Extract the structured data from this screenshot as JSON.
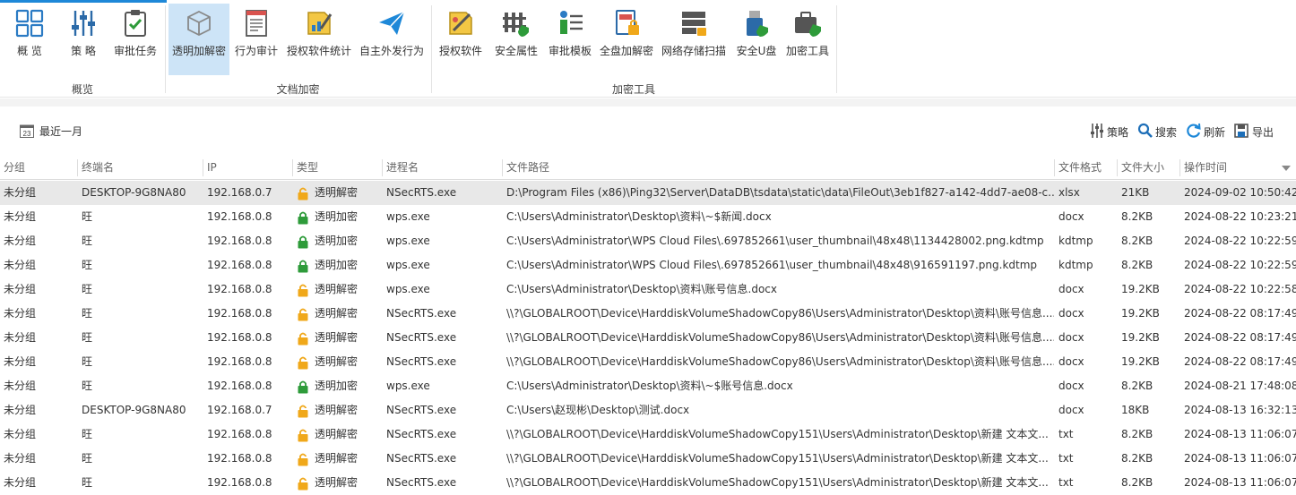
{
  "ribbon": {
    "groups": [
      {
        "label": "概览"
      },
      {
        "label": "文档加密"
      },
      {
        "label": "加密工具"
      }
    ],
    "buttons": [
      {
        "label": "概 览",
        "icon": "overview-grid-icon"
      },
      {
        "label": "策 略",
        "icon": "policy-sliders-icon"
      },
      {
        "label": "审批任务",
        "icon": "approval-clipboard-icon"
      },
      {
        "label": "透明加解密",
        "icon": "transparent-cube-icon"
      },
      {
        "label": "行为审计",
        "icon": "audit-doc-icon"
      },
      {
        "label": "授权软件统计",
        "icon": "license-stats-icon"
      },
      {
        "label": "自主外发行为",
        "icon": "send-plane-icon"
      },
      {
        "label": "授权软件",
        "icon": "license-software-icon"
      },
      {
        "label": "安全属性",
        "icon": "security-attr-icon"
      },
      {
        "label": "审批模板",
        "icon": "approval-template-icon"
      },
      {
        "label": "全盘加解密",
        "icon": "disk-encrypt-icon"
      },
      {
        "label": "网络存储扫描",
        "icon": "network-storage-icon"
      },
      {
        "label": "安全U盘",
        "icon": "secure-usb-icon"
      },
      {
        "label": "加密工具",
        "icon": "encrypt-toolbox-icon"
      }
    ]
  },
  "toolbar": {
    "date_filter": "最近一月",
    "calendar_day": "23",
    "policy": "策略",
    "search": "搜索",
    "refresh": "刷新",
    "export": "导出"
  },
  "table": {
    "columns": [
      "分组",
      "终端名",
      "IP",
      "类型",
      "进程名",
      "文件路径",
      "文件格式",
      "文件大小",
      "操作时间"
    ],
    "rows": [
      {
        "group": "未分组",
        "terminal": "DESKTOP-9G8NA80",
        "ip": "192.168.0.7",
        "type": "透明解密",
        "lock": "unlocked",
        "process": "NSecRTS.exe",
        "path": "D:\\Program Files (x86)\\Ping32\\Server\\DataDB\\tsdata\\static\\data\\FileOut\\3eb1f827-a142-4dd7-ae08-c...",
        "format": "xlsx",
        "size": "21KB",
        "time": "2024-09-02 10:50:42"
      },
      {
        "group": "未分组",
        "terminal": "旺",
        "ip": "192.168.0.8",
        "type": "透明加密",
        "lock": "locked",
        "process": "wps.exe",
        "path": "C:\\Users\\Administrator\\Desktop\\资料\\~$新闻.docx",
        "format": "docx",
        "size": "8.2KB",
        "time": "2024-08-22 10:23:21"
      },
      {
        "group": "未分组",
        "terminal": "旺",
        "ip": "192.168.0.8",
        "type": "透明加密",
        "lock": "locked",
        "process": "wps.exe",
        "path": "C:\\Users\\Administrator\\WPS Cloud Files\\.697852661\\user_thumbnail\\48x48\\1134428002.png.kdtmp",
        "format": "kdtmp",
        "size": "8.2KB",
        "time": "2024-08-22 10:22:59"
      },
      {
        "group": "未分组",
        "terminal": "旺",
        "ip": "192.168.0.8",
        "type": "透明加密",
        "lock": "locked",
        "process": "wps.exe",
        "path": "C:\\Users\\Administrator\\WPS Cloud Files\\.697852661\\user_thumbnail\\48x48\\916591197.png.kdtmp",
        "format": "kdtmp",
        "size": "8.2KB",
        "time": "2024-08-22 10:22:59"
      },
      {
        "group": "未分组",
        "terminal": "旺",
        "ip": "192.168.0.8",
        "type": "透明解密",
        "lock": "unlocked",
        "process": "wps.exe",
        "path": "C:\\Users\\Administrator\\Desktop\\资料\\账号信息.docx",
        "format": "docx",
        "size": "19.2KB",
        "time": "2024-08-22 10:22:58"
      },
      {
        "group": "未分组",
        "terminal": "旺",
        "ip": "192.168.0.8",
        "type": "透明解密",
        "lock": "unlocked",
        "process": "NSecRTS.exe",
        "path": "\\\\?\\GLOBALROOT\\Device\\HarddiskVolumeShadowCopy86\\Users\\Administrator\\Desktop\\资料\\账号信息....",
        "format": "docx",
        "size": "19.2KB",
        "time": "2024-08-22 08:17:49"
      },
      {
        "group": "未分组",
        "terminal": "旺",
        "ip": "192.168.0.8",
        "type": "透明解密",
        "lock": "unlocked",
        "process": "NSecRTS.exe",
        "path": "\\\\?\\GLOBALROOT\\Device\\HarddiskVolumeShadowCopy86\\Users\\Administrator\\Desktop\\资料\\账号信息....",
        "format": "docx",
        "size": "19.2KB",
        "time": "2024-08-22 08:17:49"
      },
      {
        "group": "未分组",
        "terminal": "旺",
        "ip": "192.168.0.8",
        "type": "透明解密",
        "lock": "unlocked",
        "process": "NSecRTS.exe",
        "path": "\\\\?\\GLOBALROOT\\Device\\HarddiskVolumeShadowCopy86\\Users\\Administrator\\Desktop\\资料\\账号信息....",
        "format": "docx",
        "size": "19.2KB",
        "time": "2024-08-22 08:17:49"
      },
      {
        "group": "未分组",
        "terminal": "旺",
        "ip": "192.168.0.8",
        "type": "透明加密",
        "lock": "locked",
        "process": "wps.exe",
        "path": "C:\\Users\\Administrator\\Desktop\\资料\\~$账号信息.docx",
        "format": "docx",
        "size": "8.2KB",
        "time": "2024-08-21 17:48:08"
      },
      {
        "group": "未分组",
        "terminal": "DESKTOP-9G8NA80",
        "ip": "192.168.0.7",
        "type": "透明解密",
        "lock": "unlocked",
        "process": "NSecRTS.exe",
        "path": "C:\\Users\\赵现彬\\Desktop\\测试.docx",
        "format": "docx",
        "size": "18KB",
        "time": "2024-08-13 16:32:13"
      },
      {
        "group": "未分组",
        "terminal": "旺",
        "ip": "192.168.0.8",
        "type": "透明解密",
        "lock": "unlocked",
        "process": "NSecRTS.exe",
        "path": "\\\\?\\GLOBALROOT\\Device\\HarddiskVolumeShadowCopy151\\Users\\Administrator\\Desktop\\新建 文本文...",
        "format": "txt",
        "size": "8.2KB",
        "time": "2024-08-13 11:06:07"
      },
      {
        "group": "未分组",
        "terminal": "旺",
        "ip": "192.168.0.8",
        "type": "透明解密",
        "lock": "unlocked",
        "process": "NSecRTS.exe",
        "path": "\\\\?\\GLOBALROOT\\Device\\HarddiskVolumeShadowCopy151\\Users\\Administrator\\Desktop\\新建 文本文...",
        "format": "txt",
        "size": "8.2KB",
        "time": "2024-08-13 11:06:07"
      },
      {
        "group": "未分组",
        "terminal": "旺",
        "ip": "192.168.0.8",
        "type": "透明解密",
        "lock": "unlocked",
        "process": "NSecRTS.exe",
        "path": "\\\\?\\GLOBALROOT\\Device\\HarddiskVolumeShadowCopy151\\Users\\Administrator\\Desktop\\新建 文本文...",
        "format": "txt",
        "size": "8.2KB",
        "time": "2024-08-13 11:06:07"
      }
    ]
  },
  "colors": {
    "accent": "#1e88d8",
    "active_tab_bg": "#cde4f7",
    "selected_row": "#e8e8e8",
    "lock_locked": "#2e9b3a",
    "lock_unlocked": "#f0a81a"
  }
}
